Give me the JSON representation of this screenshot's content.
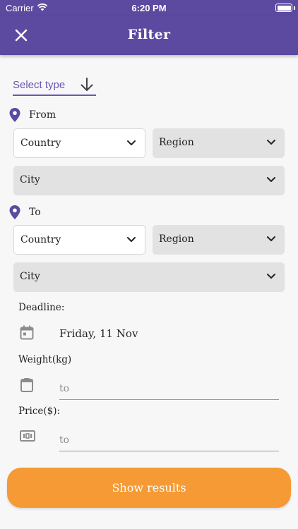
{
  "status_bar": {
    "carrier": "Carrier",
    "time": "6:20 PM"
  },
  "header": {
    "title": "Filter",
    "close_icon": "close-icon"
  },
  "select_type": {
    "label": "Select type",
    "icon": "arrow-down-icon"
  },
  "from": {
    "label": "From",
    "country": "Country",
    "region": "Region",
    "city": "City"
  },
  "to": {
    "label": "To",
    "country": "Country",
    "region": "Region",
    "city": "City"
  },
  "deadline": {
    "label": "Deadline:",
    "value": "Friday, 11 Nov"
  },
  "weight": {
    "label": "Weight(kg)",
    "placeholder": "to"
  },
  "price": {
    "label": "Price($):",
    "placeholder": "to"
  },
  "actions": {
    "show_results": "Show results"
  },
  "colors": {
    "primary": "#5b4aa0",
    "accent": "#f59a35",
    "dropdown_grey": "#e2e2e2"
  }
}
